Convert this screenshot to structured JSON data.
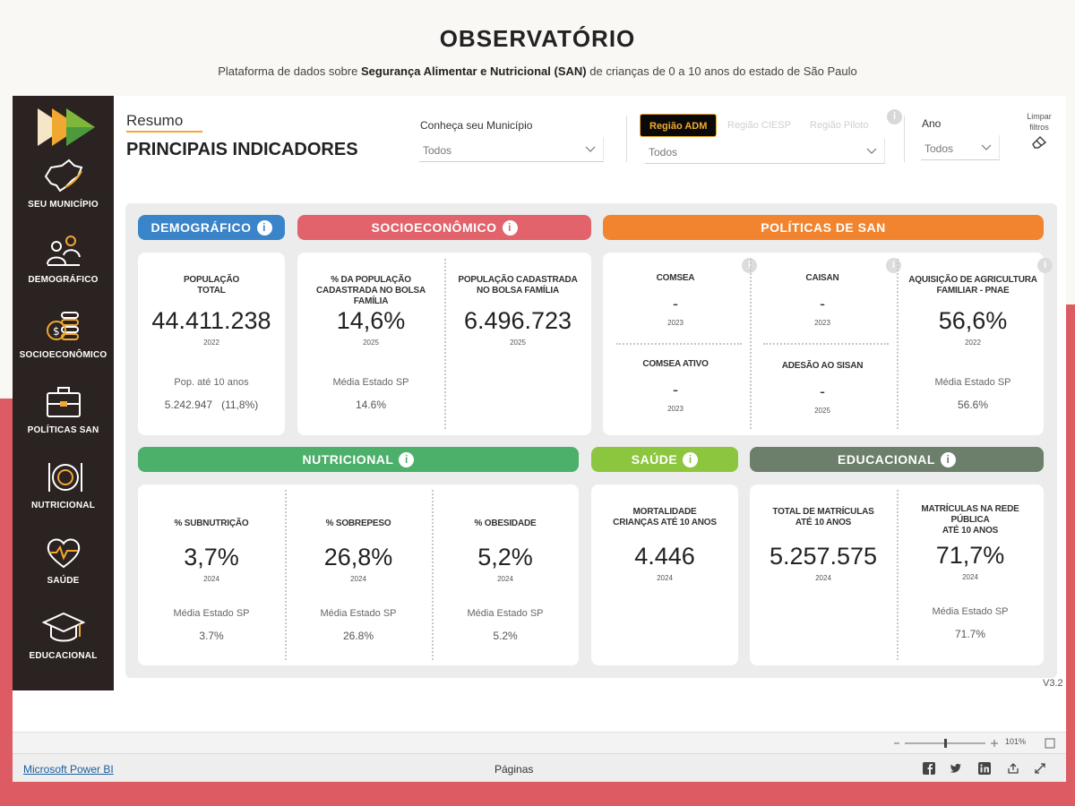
{
  "header": {
    "title": "OBSERVATÓRIO",
    "subtitle_pre": "Plataforma de dados sobre",
    "subtitle_bold": "Segurança Alimentar e Nutricional (SAN)",
    "subtitle_post": "de crianças de 0 a 10 anos do estado de São Paulo"
  },
  "sidebar": {
    "items": [
      {
        "label": "SEU MUNICÍPIO",
        "icon": "map-icon"
      },
      {
        "label": "DEMOGRÁFICO",
        "icon": "people-icon"
      },
      {
        "label": "SOCIOECONÔMICO",
        "icon": "coins-icon"
      },
      {
        "label": "POLÍTICAS SAN",
        "icon": "briefcase-icon"
      },
      {
        "label": "NUTRICIONAL",
        "icon": "plate-icon"
      },
      {
        "label": "SAÚDE",
        "icon": "heart-icon"
      },
      {
        "label": "EDUCACIONAL",
        "icon": "graduation-cap-icon"
      }
    ]
  },
  "panel": {
    "resumo": "Resumo",
    "title": "PRINCIPAIS INDICADORES",
    "municipio_label": "Conheça seu Município",
    "municipio_value": "Todos",
    "region_tabs": [
      "Região ADM",
      "Região CIESP",
      "Região Piloto"
    ],
    "region_value": "Todos",
    "ano_label": "Ano",
    "ano_value": "Todos",
    "clear_filters": "Limpar filtros",
    "info": "i"
  },
  "categories": {
    "demografico": "DEMOGRÁFICO",
    "socioeconomico": "SOCIOECONÔMICO",
    "politicas": "POLÍTICAS DE SAN",
    "nutricional": "NUTRICIONAL",
    "saude": "SAÚDE",
    "educacional": "EDUCACIONAL"
  },
  "kpis": {
    "populacao": {
      "title": "POPULAÇÃO\nTOTAL",
      "value": "44.411.238",
      "year": "2022",
      "note": "Pop. até 10 anos",
      "note_val": "5.242.947",
      "note_pct": "(11,8%)"
    },
    "bolsa_pct": {
      "title": "% DA POPULAÇÃO\nCADASTRADA NO BOLSA\nFAMÍLIA",
      "value": "14,6%",
      "year": "2025",
      "note": "Média Estado SP",
      "note_val": "14.6%"
    },
    "bolsa_abs": {
      "title": "POPULAÇÃO CADASTRADA\nNO BOLSA FAMÍLIA",
      "value": "6.496.723",
      "year": "2025"
    },
    "comsea": {
      "title": "COMSEA",
      "value": "-",
      "year": "2023"
    },
    "caisan": {
      "title": "CAISAN",
      "value": "-",
      "year": "2023"
    },
    "comsea_ativo": {
      "title": "COMSEA ATIVO",
      "value": "-",
      "year": "2023"
    },
    "adesao_sisan": {
      "title": "ADESÃO AO SISAN",
      "value": "-",
      "year": "2025"
    },
    "pnae": {
      "title": "AQUISIÇÃO DE AGRICULTURA\nFAMILIAR - PNAE",
      "value": "56,6%",
      "year": "2022",
      "note": "Média Estado SP",
      "note_val": "56.6%"
    },
    "subnutricao": {
      "title": "% SUBNUTRIÇÃO",
      "value": "3,7%",
      "year": "2024",
      "note": "Média Estado SP",
      "note_val": "3.7%"
    },
    "sobrepeso": {
      "title": "% SOBREPESO",
      "value": "26,8%",
      "year": "2024",
      "note": "Média Estado SP",
      "note_val": "26.8%"
    },
    "obesidade": {
      "title": "% OBESIDADE",
      "value": "5,2%",
      "year": "2024",
      "note": "Média Estado SP",
      "note_val": "5.2%"
    },
    "mortalidade": {
      "title": "MORTALIDADE\nCRIANÇAS ATÉ 10 ANOS",
      "value": "4.446",
      "year": "2024"
    },
    "matriculas": {
      "title": "TOTAL DE MATRÍCULAS\nATÉ 10 ANOS",
      "value": "5.257.575",
      "year": "2024"
    },
    "matriculas_publica": {
      "title": "MATRÍCULAS NA REDE\nPÚBLICA\nATÉ 10 ANOS",
      "value": "71,7%",
      "year": "2024",
      "note": "Média Estado SP",
      "note_val": "71.7%"
    }
  },
  "version": "V3.2",
  "powerbi": {
    "link": "Microsoft Power BI",
    "pages": "Páginas",
    "zoom": "101%"
  },
  "colors": {
    "demografico": "#3a84c9",
    "socioeconomico": "#e2636b",
    "politicas": "#f2842f",
    "nutricional": "#4caf6a",
    "saude": "#8cc63f",
    "educacional": "#6b7f6b",
    "accent": "#f0a830",
    "background_red": "#dd5c63"
  }
}
